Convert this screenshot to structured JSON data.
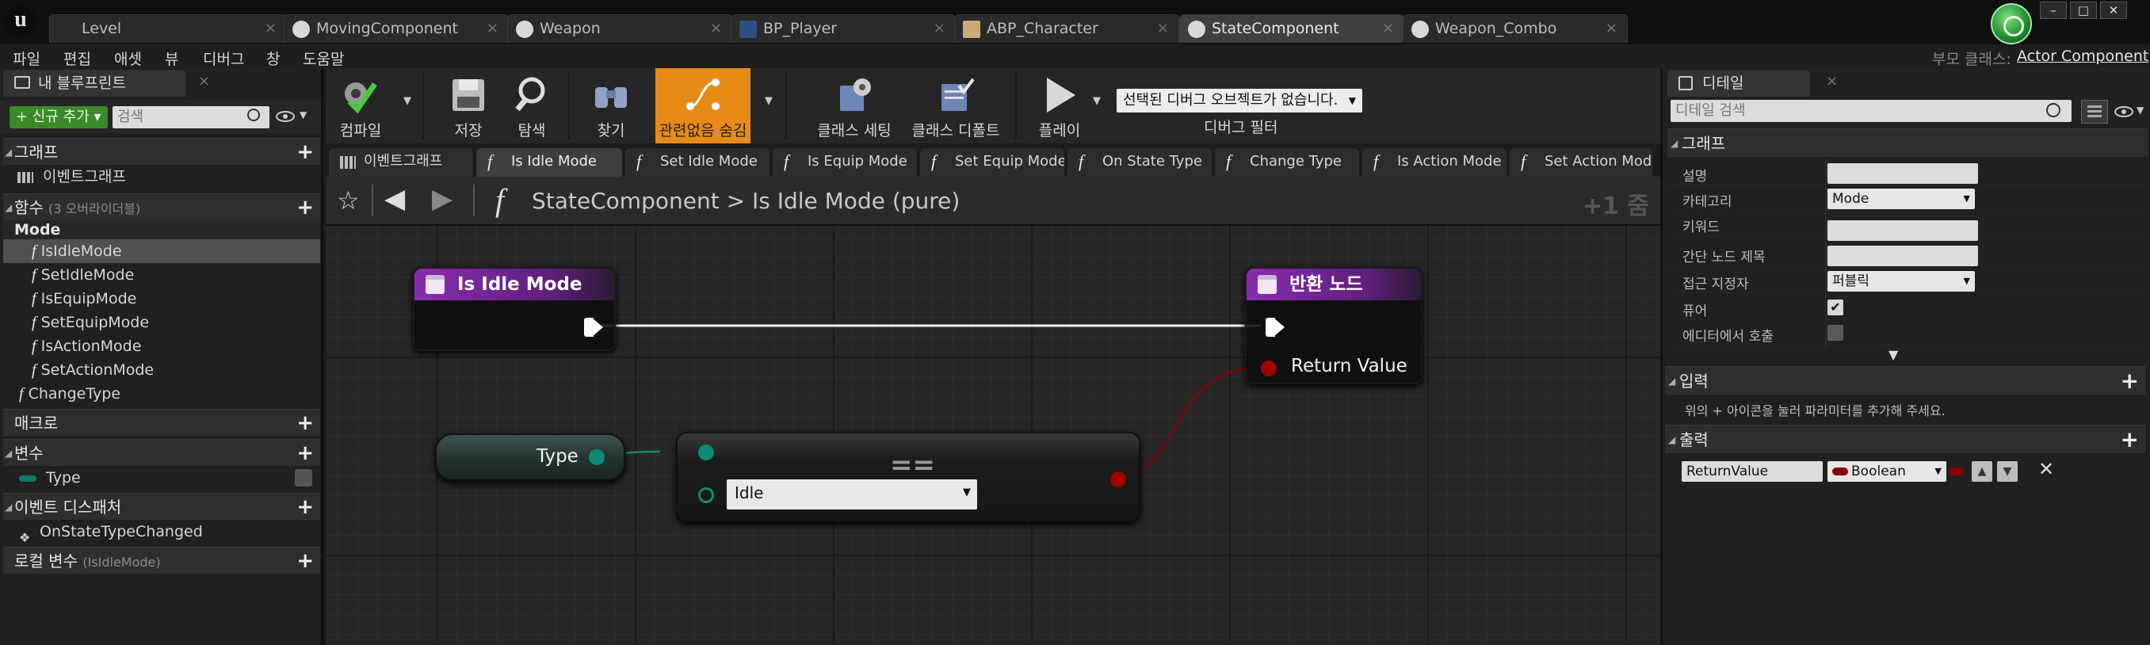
{
  "tabs": [
    {
      "label": "Level",
      "icon": "none"
    },
    {
      "label": "MovingComponent",
      "icon": "component-icon"
    },
    {
      "label": "Weapon",
      "icon": "actor-icon"
    },
    {
      "label": "BP_Player",
      "icon": "blueprint-icon"
    },
    {
      "label": "ABP_Character",
      "icon": "anim-blueprint-icon"
    },
    {
      "label": "StateComponent",
      "icon": "component-icon"
    },
    {
      "label": "Weapon_Combo",
      "icon": "actor-icon"
    }
  ],
  "active_tab": "StateComponent",
  "menu": [
    "파일",
    "편집",
    "애셋",
    "뷰",
    "디버그",
    "창",
    "도움말"
  ],
  "parent_class": {
    "label": "부모 클래스:",
    "value": "Actor Component"
  },
  "left_panel": {
    "tab_label": "내 블루프린트",
    "add_new_label": "+ 신규 추가 ▾",
    "search_placeholder": "검색",
    "sections": {
      "graphs": "그래프",
      "event_graph": "이벤트그래프",
      "functions": "함수",
      "functions_sub": "(3 오버라이더블)",
      "mode_category": "Mode",
      "macros": "매크로",
      "variables": "변수",
      "event_dispatchers": "이벤트 디스패처",
      "local_vars": "로컬 변수",
      "local_vars_sub": "(IsIdleMode)"
    },
    "functions": [
      "IsIdleMode",
      "SetIdleMode",
      "IsEquipMode",
      "SetEquipMode",
      "IsActionMode",
      "SetActionMode"
    ],
    "other_function": "ChangeType",
    "variables": [
      "Type"
    ],
    "dispatchers": [
      "OnStateTypeChanged"
    ]
  },
  "toolbar": {
    "compile": "컴파일",
    "save": "저장",
    "browse": "탐색",
    "find": "찾기",
    "hide_unrelated": "관련없음 숨김",
    "class_settings": "클래스 세팅",
    "class_defaults": "클래스 디폴트",
    "play": "플레이",
    "debug_select": "선택된 디버그 오브젝트가 없습니다.",
    "debug_filter": "디버그 필터"
  },
  "graph_tabs": [
    "이벤트그래프",
    "Is Idle Mode",
    "Set Idle Mode",
    "Is Equip Mode",
    "Set Equip Mode",
    "On State Type",
    "Change Type",
    "Is Action Mode",
    "Set Action Mode"
  ],
  "breadcrumb": {
    "owner": "StateComponent",
    "separator": ">",
    "current": "Is Idle Mode (pure)"
  },
  "zoom": "+1 줌",
  "graph": {
    "entry_node_title": "Is Idle Mode",
    "return_node_title": "반환 노드",
    "return_pin_label": "Return Value",
    "var_node_label": "Type",
    "eq_glyph": "==",
    "enum_value": "Idle"
  },
  "colors": {
    "node_header": "#8a2cb0",
    "exec_pin": "#ffffff",
    "enum_pin": "#0e8a7a",
    "bool_pin": "#a00000",
    "highlight_button": "#e88a16",
    "add_button": "#3a8a2a"
  },
  "details": {
    "tab_label": "디테일",
    "search_placeholder": "디테일 검색",
    "graph_section": "그래프",
    "rows": {
      "description": "설명",
      "category": "카테고리",
      "keywords": "키워드",
      "compact_title": "간단 노드 제목",
      "access_specifier": "접근 지정자",
      "pure": "퓨어",
      "call_in_editor": "에디터에서 호출"
    },
    "values": {
      "description": "",
      "category": "Mode",
      "keywords": "",
      "compact_title": "",
      "access_specifier": "퍼블릭"
    },
    "pure_checked": true,
    "call_in_editor_checked": false,
    "more_glyph": "▼",
    "inputs_section": "입력",
    "inputs_hint": "위의 + 아이콘을 눌러 파라미터를 추가해 주세요.",
    "outputs_section": "출력",
    "output_param": {
      "name": "ReturnValue",
      "type": "Boolean"
    }
  }
}
